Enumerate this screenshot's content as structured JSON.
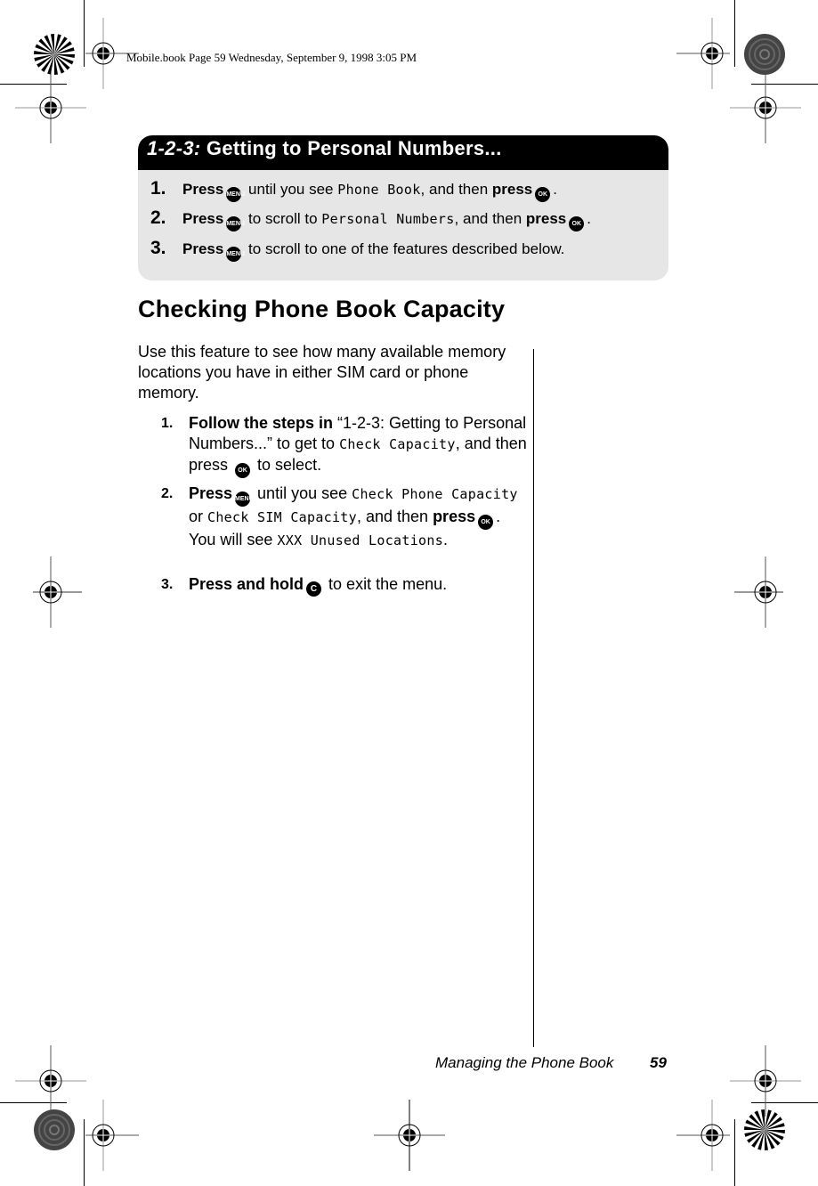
{
  "slug": "Mobile.book  Page 59  Wednesday, September 9, 1998  3:05 PM",
  "box": {
    "title_prefix": "1-2-3:",
    "title_rest": " Getting to Personal Numbers...",
    "steps": [
      {
        "num": "1.",
        "press": "Press",
        "key1": "MENU",
        "text1": " until you see ",
        "lcd": "Phone Book",
        "text2": ", and then ",
        "press2": "press",
        "key2": "OK",
        "end": "."
      },
      {
        "num": "2.",
        "press": "Press",
        "key1": "MENU",
        "text1": " to scroll to ",
        "lcd": "Personal Numbers",
        "text2": ", and then ",
        "press2": "press",
        "key2": "OK",
        "end": "."
      },
      {
        "num": "3.",
        "press": "Press",
        "key1": "MENU",
        "text1": " to scroll to one of the features described below."
      }
    ]
  },
  "section": {
    "title": "Checking Phone Book Capacity",
    "intro": "Use this feature to see how many available memory locations you have in either SIM card or phone memory.",
    "steps": [
      {
        "num": "1.",
        "bold": "Follow the steps in",
        "t1": " “1-2-3: Getting to Personal Numbers...” to get to ",
        "lcd": "Check Capacity",
        "t2": ", and then press ",
        "key": "OK",
        "t3": " to  select."
      },
      {
        "num": "2.",
        "bold": "Press",
        "key": "MENU",
        "t1": " until you see ",
        "lcd1": "Check Phone Capacity",
        "t2": " or ",
        "lcd2": "Check SIM Capacity",
        "t3": ", and then ",
        "bold2": "press",
        "key2": "OK",
        "t4": ". You will see ",
        "lcd3": "XXX Unused Locations",
        "t5": "."
      },
      {
        "num": "3.",
        "bold": "Press and hold",
        "key": "C",
        "t1": " to exit the menu."
      }
    ]
  },
  "footer": {
    "title": "Managing the Phone Book",
    "page": "59"
  }
}
